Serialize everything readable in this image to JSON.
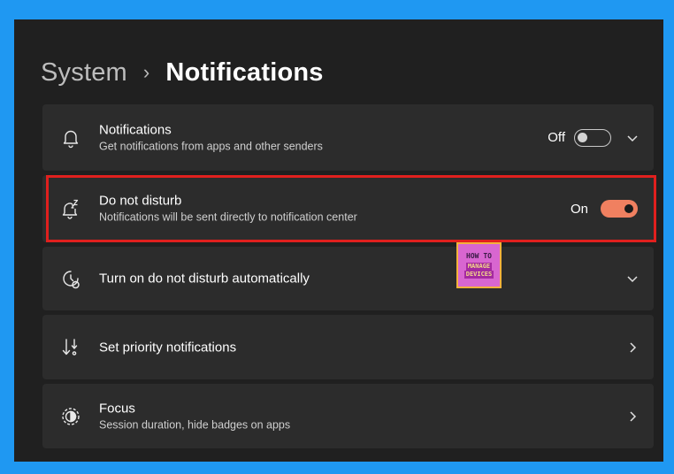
{
  "breadcrumb": {
    "parent": "System",
    "separator": "›",
    "current": "Notifications"
  },
  "settings": [
    {
      "title": "Notifications",
      "subtitle": "Get notifications from apps and other senders",
      "icon": "bell-icon",
      "state_label": "Off",
      "toggle": false,
      "expand": "chevron-down-icon"
    },
    {
      "title": "Do not disturb",
      "subtitle": "Notifications will be sent directly to notification center",
      "icon": "bell-snooze-icon",
      "state_label": "On",
      "toggle": true
    },
    {
      "title": "Turn on do not disturb automatically",
      "icon": "clock-icon",
      "expand": "chevron-down-icon"
    },
    {
      "title": "Set priority notifications",
      "icon": "priority-arrows-icon",
      "expand": "chevron-right-icon"
    },
    {
      "title": "Focus",
      "subtitle": "Session duration, hide badges on apps",
      "icon": "focus-icon",
      "expand": "chevron-right-icon"
    }
  ],
  "watermark": {
    "line1": "HOW TO",
    "line2": "MANAGE",
    "line3": "DEVICES"
  },
  "colors": {
    "accent": "#f08060",
    "highlight_border": "#e0201e",
    "card_bg": "#2c2c2c",
    "window_bg": "#202020",
    "frame_bg": "#1f98f2"
  }
}
